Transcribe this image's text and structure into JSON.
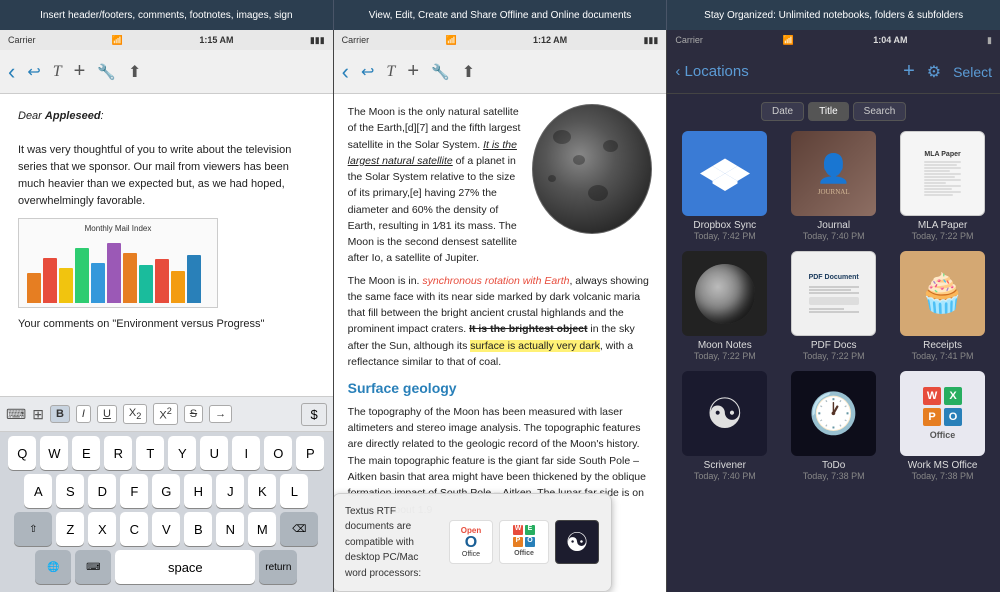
{
  "banner": {
    "section1": "Insert header/footers, comments, footnotes, images, sign",
    "section2": "View, Edit, Create and Share Offline and Online documents",
    "section3": "Stay Organized: Unlimited notebooks, folders & subfolders"
  },
  "panel1": {
    "status": {
      "carrier": "Carrier",
      "wifi": "▾",
      "time": "1:15 AM",
      "battery": "▮▮▮"
    },
    "toolbar": {
      "back": "‹",
      "undo": "↩",
      "text_t": "𝒯",
      "add": "+",
      "wrench": "🔧",
      "share": "⬆"
    },
    "letter": {
      "salutation": "Dear Appleseed:",
      "body1": "It was very thoughtful of you to write about the television series that we sponsor. Our mail from viewers has been much heavier than we expected but, as we had hoped, overwhelmingly favorable.",
      "caption": "Your comments on \"Environment versus Progress\"",
      "chart_title": "Monthly Mail Index"
    },
    "formatting": {
      "bold": "B",
      "italic": "I",
      "underline": "U",
      "subscript": "X₂",
      "superscript": "X²",
      "strikethrough": "S",
      "arrow": "→",
      "dollar": "$"
    },
    "keyboard_rows": [
      [
        "Q",
        "W",
        "E",
        "R",
        "T",
        "Y",
        "U",
        "I",
        "O",
        "P"
      ],
      [
        "A",
        "S",
        "D",
        "F",
        "G",
        "H",
        "J",
        "K",
        "L"
      ],
      [
        "⇧",
        "Z",
        "X",
        "C",
        "V",
        "B",
        "N",
        "M",
        "⌫"
      ],
      [
        "🌐",
        "⌨",
        "space",
        "return"
      ]
    ]
  },
  "panel2": {
    "status": {
      "carrier": "Carrier",
      "wifi": "▾",
      "time": "1:12 AM",
      "battery": "▮▮▮"
    },
    "toolbar": {
      "back": "‹",
      "undo": "↩",
      "text_t": "𝒯",
      "add": "+",
      "wrench": "🔧",
      "share": "⬆"
    },
    "article": {
      "intro": "The Moon is the only natural satellite of the Earth,[d][7] and the fifth largest satellite in the Solar System. It is the largest natural satellite of a planet in the Solar System relative to the size of its primary,[e] having 27% the diameter and 60% the density of Earth, resulting in 1⁄81 its mass. The Moon is the second densest satellite after Io, a satellite of Jupiter.",
      "sync_text": "synchronous rotation with Earth",
      "body2": ", always showing the same face with its near side marked by dark volcanic maria that fill between the bright ancient crustal highlands and the prominent impact craters.",
      "bold_text": "It is the brightest object",
      "body3": " in the sky after the Sun, although its ",
      "highlight_text": "surface is actually very dark",
      "body4": ", with a reflectance similar to that of coal.",
      "heading": "Surface geology",
      "body5": "The topography of the Moon has been measured with laser alt",
      "moon_intro": "The Moon is in.",
      "tooltip": "Textus RTF documents are compatible with desktop PC/Mac word processors:"
    }
  },
  "panel3": {
    "status": {
      "carrier": "Carrier",
      "wifi": "▾",
      "time": "1:04 AM",
      "battery": "▮"
    },
    "toolbar": {
      "back": "‹ Locations",
      "add": "+",
      "gear": "⚙",
      "select": "Select"
    },
    "filters": [
      "Date",
      "Title",
      "Search"
    ],
    "active_filter": "Title",
    "files": [
      {
        "name": "Dropbox Sync",
        "date": "Today, 7:42 PM",
        "type": "dropbox"
      },
      {
        "name": "Journal",
        "date": "Today, 7:40 PM",
        "type": "journal"
      },
      {
        "name": "MLA Paper",
        "date": "Today, 7:22 PM",
        "type": "mla"
      },
      {
        "name": "Moon Notes",
        "date": "Today, 7:22 PM",
        "type": "moon"
      },
      {
        "name": "PDF Docs",
        "date": "Today, 7:22 PM",
        "type": "pdf"
      },
      {
        "name": "Receipts",
        "date": "Today, 7:41 PM",
        "type": "receipts"
      },
      {
        "name": "Scrivener",
        "date": "Today, 7:40 PM",
        "type": "scrivener"
      },
      {
        "name": "ToDo",
        "date": "Today, 7:38 PM",
        "type": "todo"
      },
      {
        "name": "Work MS Office",
        "date": "Today, 7:38 PM",
        "type": "office"
      }
    ]
  },
  "icons": {
    "back_arrow": "‹",
    "undo": "↩",
    "text": "T",
    "add": "+",
    "wrench": "⚙",
    "share": "↑",
    "gear": "⚙",
    "battery_full": "▓",
    "wifi": "≋",
    "dropbox_symbol": "✦"
  }
}
